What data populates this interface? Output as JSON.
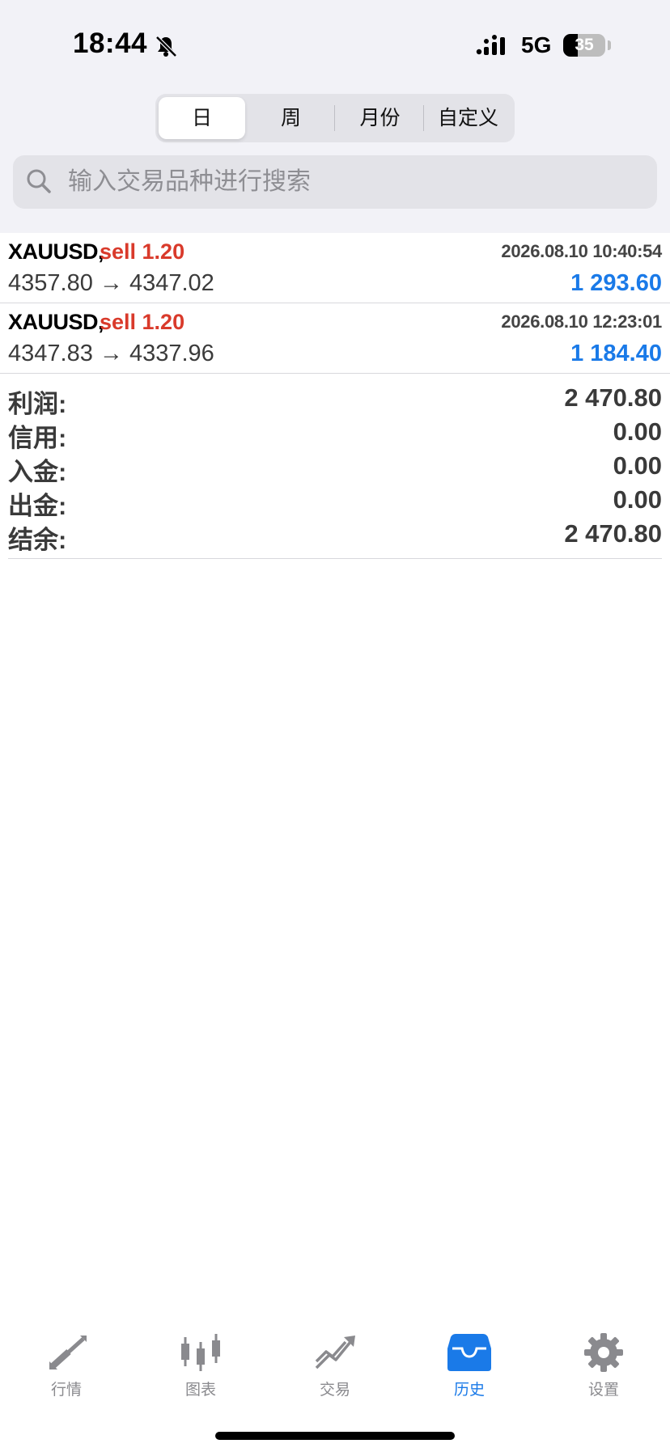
{
  "status_bar": {
    "time": "18:44",
    "network": "5G",
    "battery": "35",
    "battery_level": 0.35,
    "icons": [
      "bell-slash-icon",
      "signal-icon",
      "battery-icon"
    ]
  },
  "period_tabs": [
    {
      "label": "日",
      "active": true
    },
    {
      "label": "周",
      "active": false
    },
    {
      "label": "月份",
      "active": false
    },
    {
      "label": "自定义",
      "active": false
    }
  ],
  "search": {
    "placeholder": "输入交易品种进行搜索",
    "value": ""
  },
  "deals": [
    {
      "symbol": "XAUUSD,",
      "side": "sell 1.20",
      "datetime": "2026.08.10 10:40:54",
      "prices": "4357.80 → 4347.02",
      "profit": "1 293.60"
    },
    {
      "symbol": "XAUUSD,",
      "side": "sell 1.20",
      "datetime": "2026.08.10 12:23:01",
      "prices": "4347.83 → 4337.96",
      "profit": "1 184.40"
    }
  ],
  "summary": [
    {
      "label": "利润:",
      "value": "2 470.80"
    },
    {
      "label": "信用:",
      "value": "0.00"
    },
    {
      "label": "入金:",
      "value": "0.00"
    },
    {
      "label": "出金:",
      "value": "0.00"
    },
    {
      "label": "结余:",
      "value": "2 470.80"
    }
  ],
  "tab_bar": [
    {
      "label": "行情",
      "icon": "quotes-arrows-icon",
      "active": false
    },
    {
      "label": "图表",
      "icon": "candlestick-chart-icon",
      "active": false
    },
    {
      "label": "交易",
      "icon": "trade-trend-icon",
      "active": false
    },
    {
      "label": "历史",
      "icon": "history-inbox-icon",
      "active": true
    },
    {
      "label": "设置",
      "icon": "gear-icon",
      "active": false
    }
  ],
  "colors": {
    "accent_blue": "#1a7ae8",
    "sell_red": "#d93a2b",
    "inactive_gray": "#8a8a8e",
    "header_bg": "#f2f2f7"
  }
}
